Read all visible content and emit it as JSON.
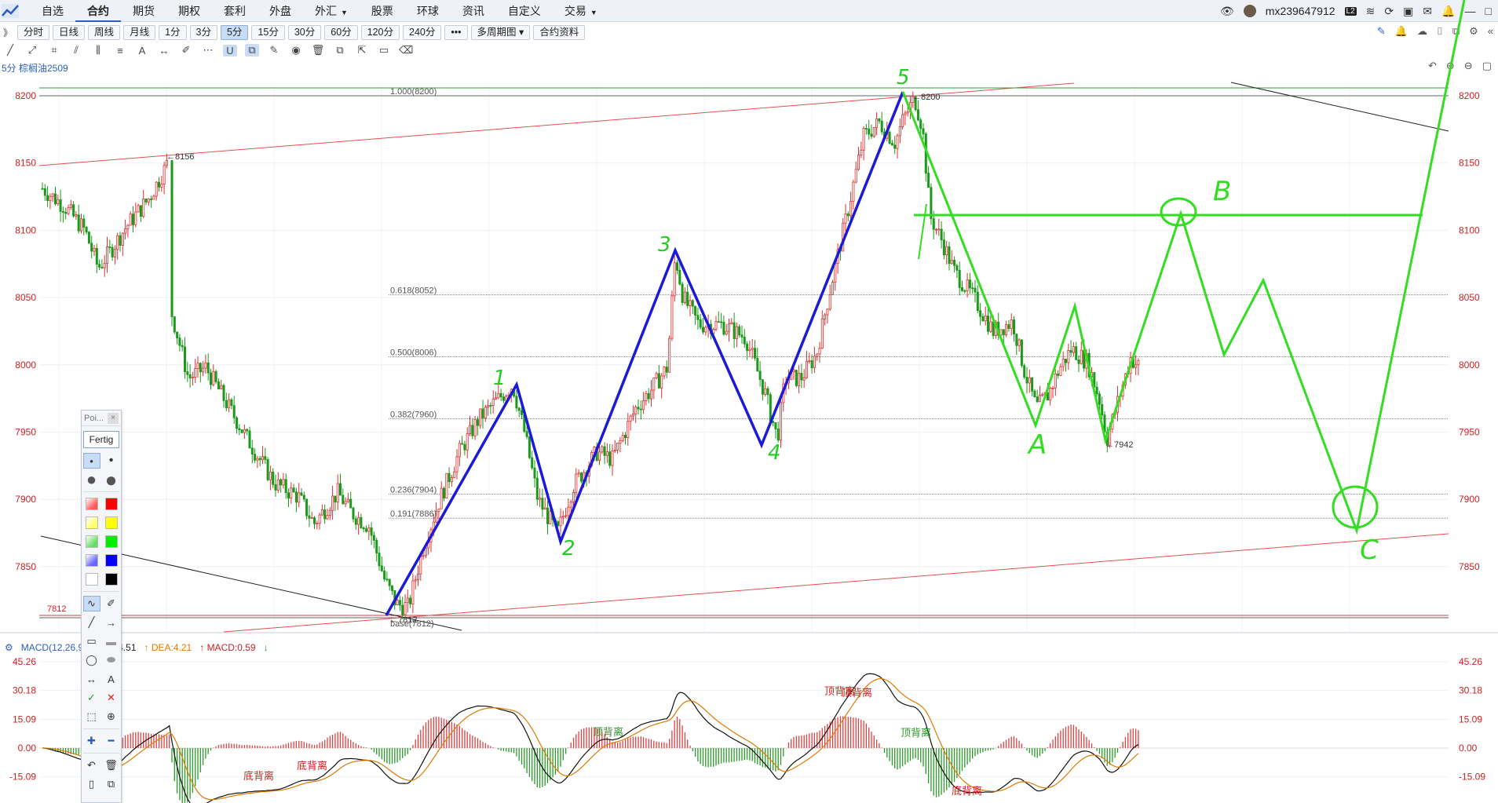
{
  "menu": {
    "items": [
      {
        "label": "自选",
        "active": false
      },
      {
        "label": "合约",
        "active": true
      },
      {
        "label": "期货",
        "active": false
      },
      {
        "label": "期权",
        "active": false
      },
      {
        "label": "套利",
        "active": false
      },
      {
        "label": "外盘",
        "active": false
      },
      {
        "label": "外汇",
        "active": false,
        "caret": true
      },
      {
        "label": "股票",
        "active": false
      },
      {
        "label": "环球",
        "active": false
      },
      {
        "label": "资讯",
        "active": false
      },
      {
        "label": "自定义",
        "active": false
      },
      {
        "label": "交易",
        "active": false,
        "caret": true
      }
    ],
    "username": "mx239647912",
    "level_badge": "L2"
  },
  "periods": {
    "expand": "》",
    "items": [
      {
        "label": "分时",
        "selected": false
      },
      {
        "label": "日线",
        "selected": false
      },
      {
        "label": "周线",
        "selected": false
      },
      {
        "label": "月线",
        "selected": false
      },
      {
        "label": "1分",
        "selected": false
      },
      {
        "label": "3分",
        "selected": false
      },
      {
        "label": "5分",
        "selected": true
      },
      {
        "label": "15分",
        "selected": false
      },
      {
        "label": "30分",
        "selected": false
      },
      {
        "label": "60分",
        "selected": false
      },
      {
        "label": "120分",
        "selected": false
      },
      {
        "label": "240分",
        "selected": false
      }
    ],
    "more": "•••",
    "multi": "多周期图",
    "info": "合约资料"
  },
  "chart_title": "5分  棕榈油2509",
  "palette": {
    "title": "Poi...",
    "close": "×",
    "done": "Fertig",
    "colors": [
      "#ff5a5a",
      "#ff0000",
      "#ffff66",
      "#ffff00",
      "#66dd66",
      "#00ee00",
      "#6666ff",
      "#0000ff",
      "#ffffff",
      "#000000"
    ]
  },
  "accent_color": "#2a5fc0",
  "main_axis": {
    "ticks": [
      "8200",
      "8150",
      "8100",
      "8050",
      "8000",
      "7950",
      "7900",
      "7850"
    ],
    "left_mark": "7812"
  },
  "macd": {
    "name": "MACD(12,26,9)",
    "diff_label": "DIFF:4.51",
    "dea_label": "DEA:4.21",
    "macd_label": "MACD:0.59",
    "ticks": [
      "45.26",
      "30.18",
      "15.09",
      "0.00",
      "-15.09"
    ],
    "divergence_labels": [
      {
        "text": "底背离"
      },
      {
        "text": "底背离"
      },
      {
        "text": "顶背离"
      },
      {
        "text": "顶背离"
      },
      {
        "text": "顶背离"
      },
      {
        "text": "顶背离"
      },
      {
        "text": "底背离"
      }
    ]
  },
  "chart_annotations": {
    "high_price": "8200",
    "low_price": "7812",
    "early_high": "8156",
    "b_wave_low": "7942",
    "fib_levels": [
      {
        "label": "1.000(8200)",
        "price": 8200
      },
      {
        "label": "0.618(8052)",
        "price": 8052
      },
      {
        "label": "0.500(8006)",
        "price": 8006
      },
      {
        "label": "0.382(7960)",
        "price": 7960
      },
      {
        "label": "0.236(7904)",
        "price": 7904
      },
      {
        "label": "0.191(7886)",
        "price": 7886
      },
      {
        "label": "base(7812)",
        "price": 7812
      }
    ],
    "wave_labels_blue": [
      "1",
      "2",
      "3",
      "4",
      "5"
    ],
    "wave_labels_green": [
      "A",
      "B",
      "C"
    ]
  },
  "chart_data": {
    "type": "candlestick",
    "instrument": "棕榈油2509",
    "period": "5分",
    "ylim": [
      7812,
      8200
    ],
    "wave_count_points": [
      {
        "label": "base",
        "price": 7812
      },
      {
        "label": "1",
        "price": 7985
      },
      {
        "label": "2",
        "price": 7868
      },
      {
        "label": "3",
        "price": 8085
      },
      {
        "label": "4",
        "price": 7940
      },
      {
        "label": "5",
        "price": 8200
      }
    ],
    "abc_projection": [
      {
        "label": "A",
        "price": 7955
      },
      {
        "label": "B",
        "price": 8110
      },
      {
        "label": "C",
        "price": 7875
      }
    ]
  }
}
